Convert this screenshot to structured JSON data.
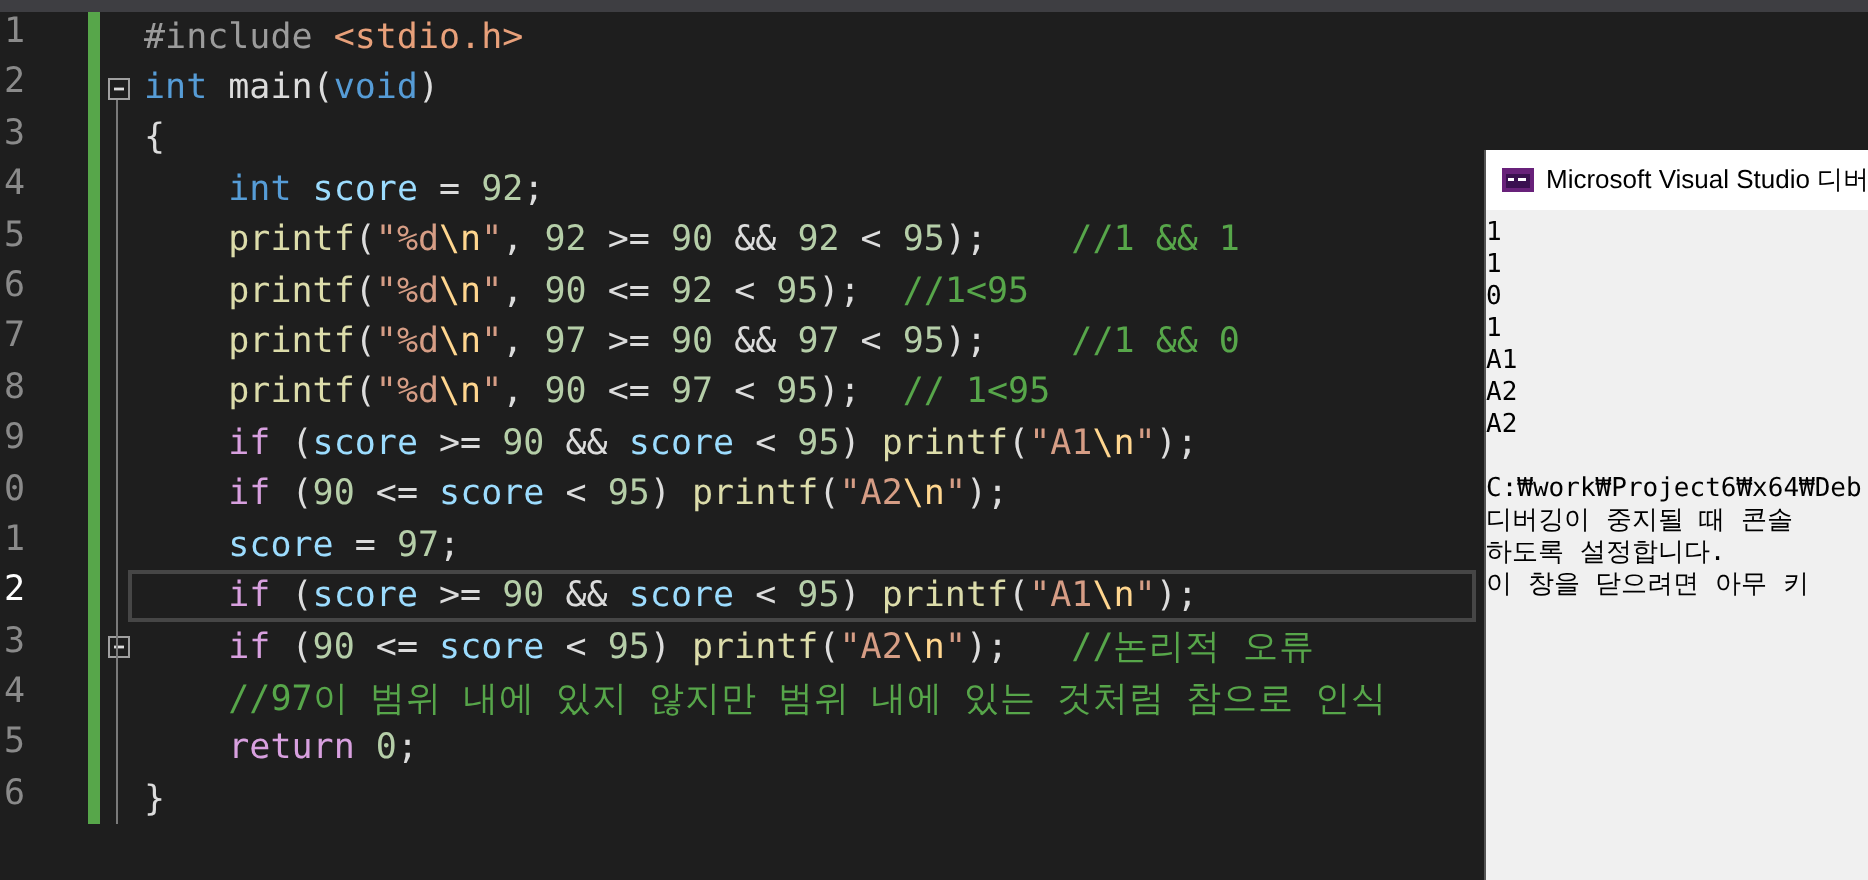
{
  "editor": {
    "lines": [
      {
        "number": "1",
        "current": false,
        "fold": false,
        "tokens": [
          {
            "kind": "preproc",
            "text": "#include "
          },
          {
            "kind": "header",
            "text": "<stdio.h>"
          }
        ]
      },
      {
        "number": "2",
        "current": false,
        "fold": true,
        "tokens": [
          {
            "kind": "keyword",
            "text": "int"
          },
          {
            "kind": "plain",
            "text": " main("
          },
          {
            "kind": "keyword",
            "text": "void"
          },
          {
            "kind": "plain",
            "text": ")"
          }
        ]
      },
      {
        "number": "3",
        "current": false,
        "fold": false,
        "tokens": [
          {
            "kind": "plain",
            "text": "{"
          }
        ]
      },
      {
        "number": "4",
        "current": false,
        "fold": false,
        "tokens": [
          {
            "kind": "keyword",
            "text": "    int"
          },
          {
            "kind": "variable",
            "text": " score"
          },
          {
            "kind": "plain",
            "text": " = "
          },
          {
            "kind": "number",
            "text": "92"
          },
          {
            "kind": "plain",
            "text": ";"
          }
        ]
      },
      {
        "number": "5",
        "current": false,
        "fold": false,
        "tokens": [
          {
            "kind": "function",
            "text": "    printf"
          },
          {
            "kind": "plain",
            "text": "("
          },
          {
            "kind": "string",
            "text": "\"%d"
          },
          {
            "kind": "escape",
            "text": "\\n"
          },
          {
            "kind": "string",
            "text": "\""
          },
          {
            "kind": "plain",
            "text": ", "
          },
          {
            "kind": "number",
            "text": "92"
          },
          {
            "kind": "plain",
            "text": " >= "
          },
          {
            "kind": "number",
            "text": "90"
          },
          {
            "kind": "plain",
            "text": " && "
          },
          {
            "kind": "number",
            "text": "92"
          },
          {
            "kind": "plain",
            "text": " < "
          },
          {
            "kind": "number",
            "text": "95"
          },
          {
            "kind": "plain",
            "text": ");    "
          },
          {
            "kind": "comment",
            "text": "//1 && 1"
          }
        ]
      },
      {
        "number": "6",
        "current": false,
        "fold": false,
        "tokens": [
          {
            "kind": "function",
            "text": "    printf"
          },
          {
            "kind": "plain",
            "text": "("
          },
          {
            "kind": "string",
            "text": "\"%d"
          },
          {
            "kind": "escape",
            "text": "\\n"
          },
          {
            "kind": "string",
            "text": "\""
          },
          {
            "kind": "plain",
            "text": ", "
          },
          {
            "kind": "number",
            "text": "90"
          },
          {
            "kind": "plain",
            "text": " <= "
          },
          {
            "kind": "number",
            "text": "92"
          },
          {
            "kind": "plain",
            "text": " < "
          },
          {
            "kind": "number",
            "text": "95"
          },
          {
            "kind": "plain",
            "text": ");  "
          },
          {
            "kind": "comment",
            "text": "//1<95"
          }
        ]
      },
      {
        "number": "7",
        "current": false,
        "fold": false,
        "tokens": [
          {
            "kind": "function",
            "text": "    printf"
          },
          {
            "kind": "plain",
            "text": "("
          },
          {
            "kind": "string",
            "text": "\"%d"
          },
          {
            "kind": "escape",
            "text": "\\n"
          },
          {
            "kind": "string",
            "text": "\""
          },
          {
            "kind": "plain",
            "text": ", "
          },
          {
            "kind": "number",
            "text": "97"
          },
          {
            "kind": "plain",
            "text": " >= "
          },
          {
            "kind": "number",
            "text": "90"
          },
          {
            "kind": "plain",
            "text": " && "
          },
          {
            "kind": "number",
            "text": "97"
          },
          {
            "kind": "plain",
            "text": " < "
          },
          {
            "kind": "number",
            "text": "95"
          },
          {
            "kind": "plain",
            "text": ");    "
          },
          {
            "kind": "comment",
            "text": "//1 && 0"
          }
        ]
      },
      {
        "number": "8",
        "current": false,
        "fold": false,
        "tokens": [
          {
            "kind": "function",
            "text": "    printf"
          },
          {
            "kind": "plain",
            "text": "("
          },
          {
            "kind": "string",
            "text": "\"%d"
          },
          {
            "kind": "escape",
            "text": "\\n"
          },
          {
            "kind": "string",
            "text": "\""
          },
          {
            "kind": "plain",
            "text": ", "
          },
          {
            "kind": "number",
            "text": "90"
          },
          {
            "kind": "plain",
            "text": " <= "
          },
          {
            "kind": "number",
            "text": "97"
          },
          {
            "kind": "plain",
            "text": " < "
          },
          {
            "kind": "number",
            "text": "95"
          },
          {
            "kind": "plain",
            "text": ");  "
          },
          {
            "kind": "comment",
            "text": "// 1<95"
          }
        ]
      },
      {
        "number": "9",
        "current": false,
        "fold": false,
        "tokens": [
          {
            "kind": "control",
            "text": "    if"
          },
          {
            "kind": "plain",
            "text": " ("
          },
          {
            "kind": "variable",
            "text": "score"
          },
          {
            "kind": "plain",
            "text": " >= "
          },
          {
            "kind": "number",
            "text": "90"
          },
          {
            "kind": "plain",
            "text": " && "
          },
          {
            "kind": "variable",
            "text": "score"
          },
          {
            "kind": "plain",
            "text": " < "
          },
          {
            "kind": "number",
            "text": "95"
          },
          {
            "kind": "plain",
            "text": ") "
          },
          {
            "kind": "function",
            "text": "printf"
          },
          {
            "kind": "plain",
            "text": "("
          },
          {
            "kind": "string",
            "text": "\"A1"
          },
          {
            "kind": "escape",
            "text": "\\n"
          },
          {
            "kind": "string",
            "text": "\""
          },
          {
            "kind": "plain",
            "text": ");"
          }
        ]
      },
      {
        "number": "0",
        "current": false,
        "fold": false,
        "tokens": [
          {
            "kind": "control",
            "text": "    if"
          },
          {
            "kind": "plain",
            "text": " ("
          },
          {
            "kind": "number",
            "text": "90"
          },
          {
            "kind": "plain",
            "text": " <= "
          },
          {
            "kind": "variable",
            "text": "score"
          },
          {
            "kind": "plain",
            "text": " < "
          },
          {
            "kind": "number",
            "text": "95"
          },
          {
            "kind": "plain",
            "text": ") "
          },
          {
            "kind": "function",
            "text": "printf"
          },
          {
            "kind": "plain",
            "text": "("
          },
          {
            "kind": "string",
            "text": "\"A2"
          },
          {
            "kind": "escape",
            "text": "\\n"
          },
          {
            "kind": "string",
            "text": "\""
          },
          {
            "kind": "plain",
            "text": ");"
          }
        ]
      },
      {
        "number": "1",
        "current": false,
        "fold": false,
        "tokens": [
          {
            "kind": "variable",
            "text": "    score"
          },
          {
            "kind": "plain",
            "text": " = "
          },
          {
            "kind": "number",
            "text": "97"
          },
          {
            "kind": "plain",
            "text": ";"
          }
        ]
      },
      {
        "number": "2",
        "current": true,
        "fold": false,
        "tokens": [
          {
            "kind": "control",
            "text": "    if"
          },
          {
            "kind": "plain",
            "text": " ("
          },
          {
            "kind": "variable",
            "text": "score"
          },
          {
            "kind": "plain",
            "text": " >= "
          },
          {
            "kind": "number",
            "text": "90"
          },
          {
            "kind": "plain",
            "text": " && "
          },
          {
            "kind": "variable",
            "text": "score"
          },
          {
            "kind": "plain",
            "text": " < "
          },
          {
            "kind": "number",
            "text": "95"
          },
          {
            "kind": "plain",
            "text": ") "
          },
          {
            "kind": "function",
            "text": "printf"
          },
          {
            "kind": "plain",
            "text": "("
          },
          {
            "kind": "string",
            "text": "\"A1"
          },
          {
            "kind": "escape",
            "text": "\\n"
          },
          {
            "kind": "string",
            "text": "\""
          },
          {
            "kind": "plain",
            "text": ");"
          }
        ]
      },
      {
        "number": "3",
        "current": false,
        "fold": true,
        "tokens": [
          {
            "kind": "control",
            "text": "    if"
          },
          {
            "kind": "plain",
            "text": " ("
          },
          {
            "kind": "number",
            "text": "90"
          },
          {
            "kind": "plain",
            "text": " <= "
          },
          {
            "kind": "variable",
            "text": "score"
          },
          {
            "kind": "plain",
            "text": " < "
          },
          {
            "kind": "number",
            "text": "95"
          },
          {
            "kind": "plain",
            "text": ") "
          },
          {
            "kind": "function",
            "text": "printf"
          },
          {
            "kind": "plain",
            "text": "("
          },
          {
            "kind": "string",
            "text": "\"A2"
          },
          {
            "kind": "escape",
            "text": "\\n"
          },
          {
            "kind": "string",
            "text": "\""
          },
          {
            "kind": "plain",
            "text": ");   "
          },
          {
            "kind": "comment",
            "text": "//논리적 오류"
          }
        ]
      },
      {
        "number": "4",
        "current": false,
        "fold": false,
        "tokens": [
          {
            "kind": "comment",
            "text": "    //97이 범위 내에 있지 않지만 범위 내에 있는 것처럼 참으로 인식"
          }
        ]
      },
      {
        "number": "5",
        "current": false,
        "fold": false,
        "tokens": [
          {
            "kind": "control",
            "text": "    return"
          },
          {
            "kind": "number",
            "text": " 0"
          },
          {
            "kind": "plain",
            "text": ";"
          }
        ]
      },
      {
        "number": "6",
        "current": false,
        "fold": false,
        "tokens": [
          {
            "kind": "plain",
            "text": "}"
          }
        ]
      }
    ]
  },
  "console": {
    "title": "Microsoft Visual Studio 디버",
    "output": [
      "1",
      "1",
      "0",
      "1",
      "A1",
      "A2",
      "A2"
    ],
    "messages": [
      "C:₩work₩Project6₩x64₩Deb",
      "디버깅이 중지될 때 콘솔",
      "하도록 설정합니다.",
      "이 창을 닫으려면 아무 키"
    ]
  }
}
